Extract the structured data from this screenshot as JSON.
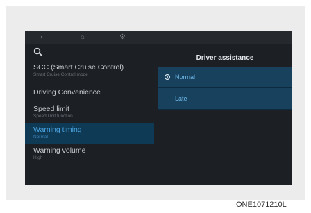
{
  "topbar": {
    "back_icon": "‹",
    "home_icon": "⌂",
    "gear_icon": "⚙"
  },
  "search": {
    "icon": "search-icon"
  },
  "menu": {
    "items": [
      {
        "label": "SCC (Smart Cruise Control)",
        "sub": "Smart Cruise Control mode"
      },
      {
        "label": "Driving Convenience",
        "sub": ""
      },
      {
        "label": "Speed limit",
        "sub": "Speed limit function"
      },
      {
        "label": "Warning timing",
        "sub": "Normal"
      },
      {
        "label": "Warning volume",
        "sub": "High"
      }
    ]
  },
  "panel": {
    "title": "Driver assistance",
    "options": [
      {
        "label": "Normal",
        "selected": true
      },
      {
        "label": "Late",
        "selected": false
      }
    ]
  },
  "caption": "ONE1071210L"
}
